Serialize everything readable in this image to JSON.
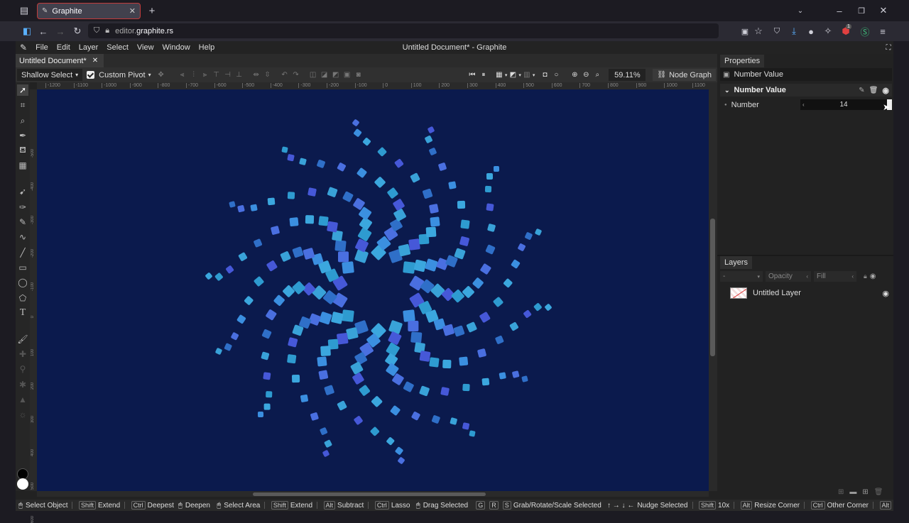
{
  "browser": {
    "tab_title": "Graphite",
    "url_prefix": "editor.",
    "url_domain": "graphite.rs",
    "extension_badge": "1"
  },
  "app": {
    "title": "Untitled Document* - Graphite",
    "menu": [
      "File",
      "Edit",
      "Layer",
      "Select",
      "View",
      "Window",
      "Help"
    ],
    "document_tab": "Untitled Document*"
  },
  "toolbar": {
    "select_mode": "Shallow Select",
    "pivot": "Custom Pivot",
    "zoom": "59.11%",
    "node_graph": "Node Graph"
  },
  "ruler": {
    "ticks": [
      "-1200",
      "-1100",
      "-1000",
      "-900",
      "-800",
      "-700",
      "-600",
      "-500",
      "-400",
      "-300",
      "-200",
      "-100",
      "0",
      "100",
      "200",
      "300",
      "400",
      "500",
      "600",
      "700",
      "800",
      "900",
      "1000",
      "1100"
    ],
    "left_ticks": [
      "-500",
      "-400",
      "-300",
      "-200",
      "-100",
      "0",
      "100",
      "200",
      "300",
      "400",
      "500",
      "600"
    ]
  },
  "properties": {
    "header": "Properties",
    "breadcrumb": "Number Value",
    "section": "Number Value",
    "field_label": "Number",
    "field_value": "14"
  },
  "layers": {
    "header": "Layers",
    "blend": "-",
    "opacity": "Opacity",
    "fill": "Fill",
    "items": [
      {
        "name": "Untitled Layer"
      }
    ]
  },
  "status": {
    "select_object": "Select Object",
    "extend": "Extend",
    "deepest": "Deepest",
    "deepen": "Deepen",
    "select_area": "Select Area",
    "extend2": "Extend",
    "subtract": "Subtract",
    "lasso": "Lasso",
    "drag_selected": "Drag Selected",
    "grab": "Grab/Rotate/Scale Selected",
    "nudge": "Nudge Selected",
    "ten_x": "10x",
    "resize_corner": "Resize Corner",
    "other_corner": "Other Corner",
    "k_shift": "Shift",
    "k_ctrl": "Ctrl",
    "k_alt": "Alt",
    "k_g": "G",
    "k_r": "R",
    "k_s": "S"
  },
  "colors": {
    "canvas": "#0b1a4d",
    "accent": "#4a7bd8"
  },
  "art": {
    "arms": 14
  }
}
